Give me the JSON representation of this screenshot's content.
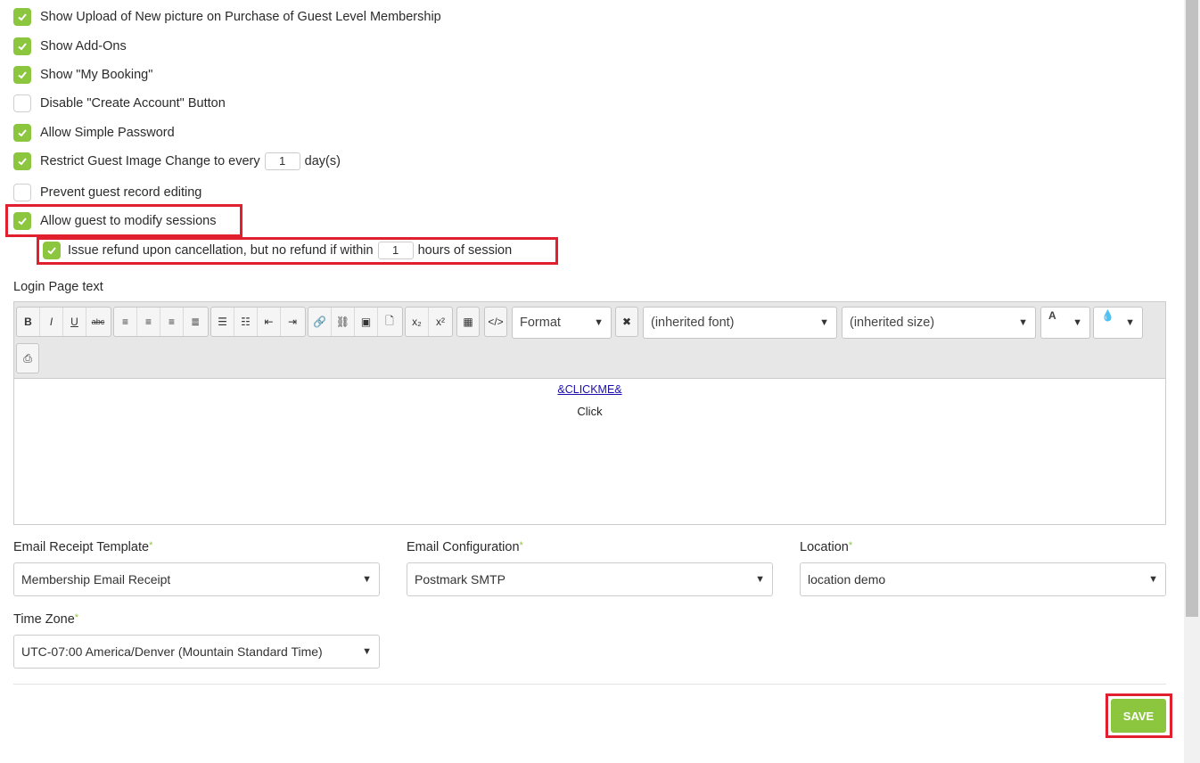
{
  "options": [
    {
      "label": "Show Upload of New picture on Purchase of Guest Level Membership",
      "checked": true
    },
    {
      "label": "Show Add-Ons",
      "checked": true
    },
    {
      "label": "Show \"My Booking\"",
      "checked": true
    },
    {
      "label": "Disable \"Create Account\" Button",
      "checked": false
    },
    {
      "label": "Allow Simple Password",
      "checked": true
    },
    {
      "label": "Restrict Guest Image Change to every",
      "checked": true,
      "value": "1",
      "suffix": "day(s)"
    },
    {
      "label": "Prevent guest record editing",
      "checked": false
    },
    {
      "label": "Allow guest to modify sessions",
      "checked": true
    }
  ],
  "refund_option": {
    "label": "Issue refund upon cancellation, but no refund if within",
    "checked": true,
    "value": "1",
    "suffix": "hours of session"
  },
  "login_page": {
    "label": "Login Page text",
    "toolbar": {
      "format": "Format",
      "font": "(inherited font)",
      "size": "(inherited size)",
      "text_color_glyph": "A"
    },
    "content_link": "&CLICKME&",
    "content_text": "Click"
  },
  "fields": {
    "email_receipt": {
      "label": "Email Receipt Template",
      "value": "Membership Email Receipt"
    },
    "email_config": {
      "label": "Email Configuration",
      "value": "Postmark SMTP"
    },
    "location": {
      "label": "Location",
      "value": "location demo"
    },
    "time_zone": {
      "label": "Time Zone",
      "value": "UTC-07:00 America/Denver (Mountain Standard Time)"
    }
  },
  "required_mark": "*",
  "save_label": "SAVE",
  "accent_color": "#8cc63f",
  "highlight_color": "#e0202e"
}
